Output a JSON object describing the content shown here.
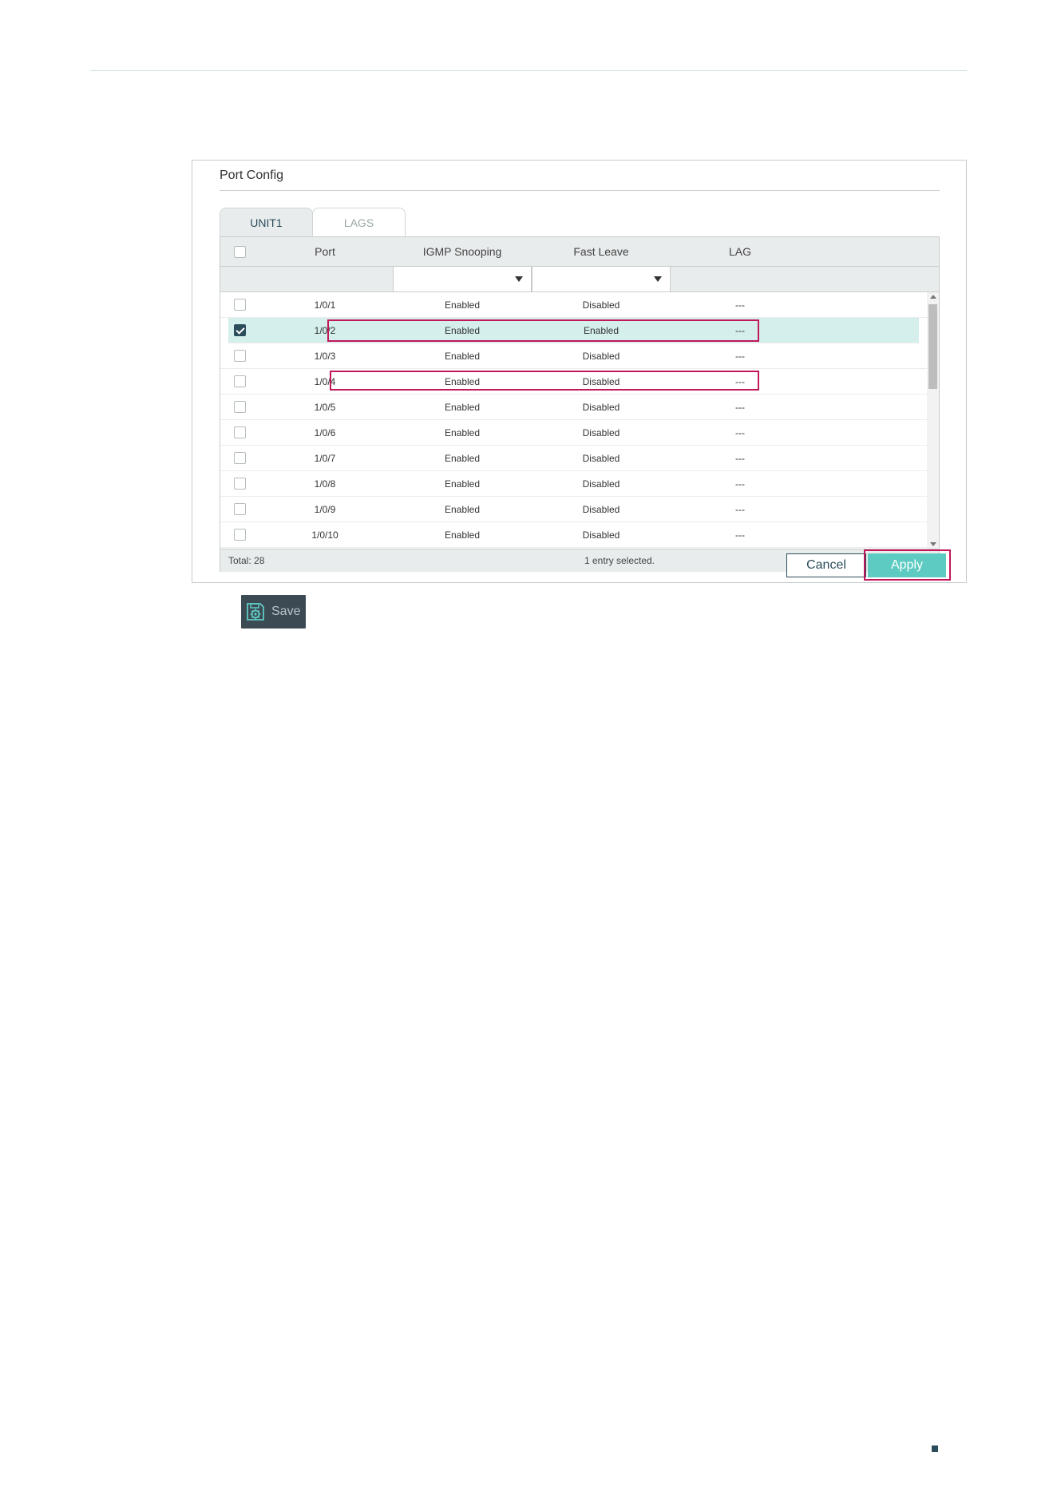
{
  "panel": {
    "title": "Port Config"
  },
  "tabs": [
    {
      "label": "UNIT1",
      "active": true
    },
    {
      "label": "LAGS",
      "active": false
    }
  ],
  "table": {
    "columns": {
      "port": "Port",
      "igmp": "IGMP Snooping",
      "fast_leave": "Fast Leave",
      "lag": "LAG"
    },
    "filters": {
      "igmp": "",
      "fast_leave": ""
    },
    "rows": [
      {
        "port": "1/0/1",
        "igmp": "Enabled",
        "fast_leave": "Disabled",
        "lag": "---",
        "checked": false,
        "highlighted": false
      },
      {
        "port": "1/0/2",
        "igmp": "Enabled",
        "fast_leave": "Enabled",
        "lag": "---",
        "checked": true,
        "highlighted": true
      },
      {
        "port": "1/0/3",
        "igmp": "Enabled",
        "fast_leave": "Disabled",
        "lag": "---",
        "checked": false,
        "highlighted": false
      },
      {
        "port": "1/0/4",
        "igmp": "Enabled",
        "fast_leave": "Disabled",
        "lag": "---",
        "checked": false,
        "highlighted": true
      },
      {
        "port": "1/0/5",
        "igmp": "Enabled",
        "fast_leave": "Disabled",
        "lag": "---",
        "checked": false,
        "highlighted": false
      },
      {
        "port": "1/0/6",
        "igmp": "Enabled",
        "fast_leave": "Disabled",
        "lag": "---",
        "checked": false,
        "highlighted": false
      },
      {
        "port": "1/0/7",
        "igmp": "Enabled",
        "fast_leave": "Disabled",
        "lag": "---",
        "checked": false,
        "highlighted": false
      },
      {
        "port": "1/0/8",
        "igmp": "Enabled",
        "fast_leave": "Disabled",
        "lag": "---",
        "checked": false,
        "highlighted": false
      },
      {
        "port": "1/0/9",
        "igmp": "Enabled",
        "fast_leave": "Disabled",
        "lag": "---",
        "checked": false,
        "highlighted": false
      },
      {
        "port": "1/0/10",
        "igmp": "Enabled",
        "fast_leave": "Disabled",
        "lag": "---",
        "checked": false,
        "highlighted": false
      }
    ],
    "footer": {
      "total": "Total: 28",
      "selected": "1 entry selected."
    }
  },
  "buttons": {
    "cancel": "Cancel",
    "apply": "Apply",
    "save": "Save"
  },
  "icons": {
    "save": "save-gear-icon",
    "dropdown": "chevron-down-icon",
    "checkbox": "checkbox-icon"
  },
  "colors": {
    "accent": "#5ecbc3",
    "dark": "#2b4c5a",
    "highlight": "#c2185b",
    "selected_row": "#d4efec"
  }
}
